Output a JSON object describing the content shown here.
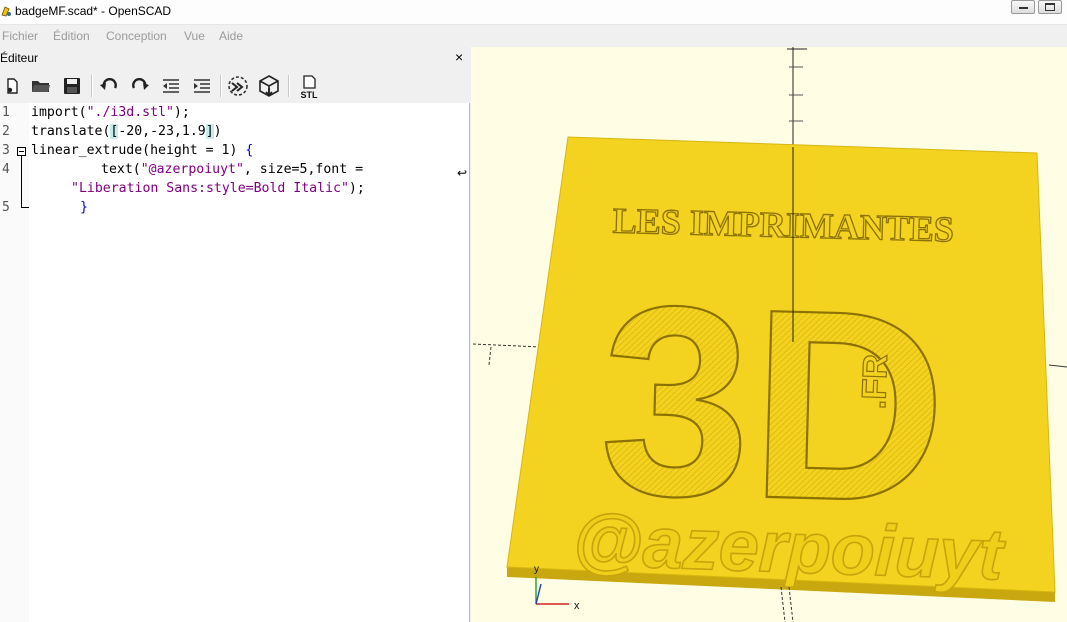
{
  "window": {
    "title": "badgeMF.scad* - OpenSCAD",
    "colors": {
      "viewport_bg": "#fffee4",
      "model": "#f5d62a",
      "model_text": "#d9b70f"
    }
  },
  "menu": {
    "items": [
      {
        "label": "Fichier"
      },
      {
        "label": "Édition"
      },
      {
        "label": "Conception"
      },
      {
        "label": "Vue"
      },
      {
        "label": "Aide"
      }
    ]
  },
  "editor_dock": {
    "title": "Éditeur",
    "close_label": "×",
    "toolbar": [
      {
        "icon": "new-file-icon"
      },
      {
        "icon": "open-folder-icon"
      },
      {
        "icon": "save-icon"
      },
      {
        "icon": "undo-icon"
      },
      {
        "icon": "redo-icon"
      },
      {
        "icon": "unindent-icon"
      },
      {
        "icon": "indent-icon"
      },
      {
        "icon": "preview-icon"
      },
      {
        "icon": "render-icon"
      },
      {
        "icon": "export-stl-icon",
        "label": "STL"
      }
    ]
  },
  "code": {
    "line_numbers": [
      "1",
      "2",
      "3",
      "4",
      "5"
    ],
    "line1": {
      "a": "import(",
      "b": "\"./i3d.stl\"",
      "c": ");"
    },
    "line2": {
      "a": "translate(",
      "b": "[",
      "c": "-20,-23,1.9",
      "d": "]",
      "e": ")"
    },
    "line3": {
      "a": "linear_extrude(height = 1) ",
      "b": "{"
    },
    "line4": {
      "a": "text(",
      "b": "\"@azerpoiuyt\"",
      "c": ", size=5,font = "
    },
    "line4b": {
      "a": "\"Liberation Sans:style=Bold Italic\"",
      "b": ");"
    },
    "line5": {
      "a": "}"
    },
    "wrap_marker": "↩"
  },
  "model": {
    "headline": "LES IMPRIMANTES",
    "big_text": "3D",
    "fr_text": ".FR",
    "handle": "@azerpoiuyt"
  },
  "axes": {
    "x_label": "x",
    "y_label": "y"
  }
}
